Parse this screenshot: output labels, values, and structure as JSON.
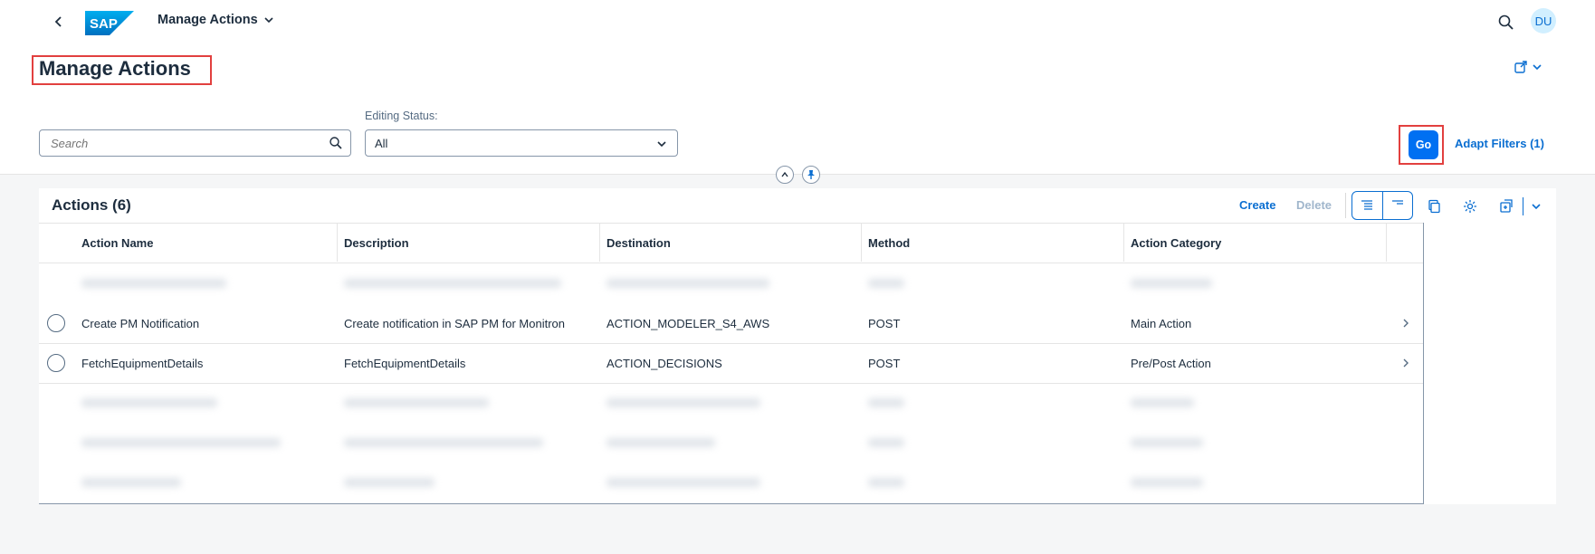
{
  "shell": {
    "app_title": "Manage Actions",
    "avatar_initials": "DU",
    "logo_text": "SAP"
  },
  "page": {
    "title": "Manage Actions"
  },
  "filters": {
    "search_placeholder": "Search",
    "editing_status_label": "Editing Status:",
    "editing_status_value": "All",
    "go_label": "Go",
    "adapt_filters_label": "Adapt Filters (1)"
  },
  "table": {
    "title": "Actions (6)",
    "create_label": "Create",
    "delete_label": "Delete",
    "columns": [
      "Action Name",
      "Description",
      "Destination",
      "Method",
      "Action Category"
    ],
    "rows": [
      {
        "action_name": "Create PM Notification",
        "description": "Create notification in SAP PM for Monitron",
        "destination": "ACTION_MODELER_S4_AWS",
        "method": "POST",
        "category": "Main Action"
      },
      {
        "action_name": "FetchEquipmentDetails",
        "description": "FetchEquipmentDetails",
        "destination": "ACTION_DECISIONS",
        "method": "POST",
        "category": "Pre/Post Action"
      }
    ]
  },
  "colors": {
    "accent": "#0a6ed1",
    "go_button": "#0070f2",
    "highlight_border": "#e2403f"
  }
}
